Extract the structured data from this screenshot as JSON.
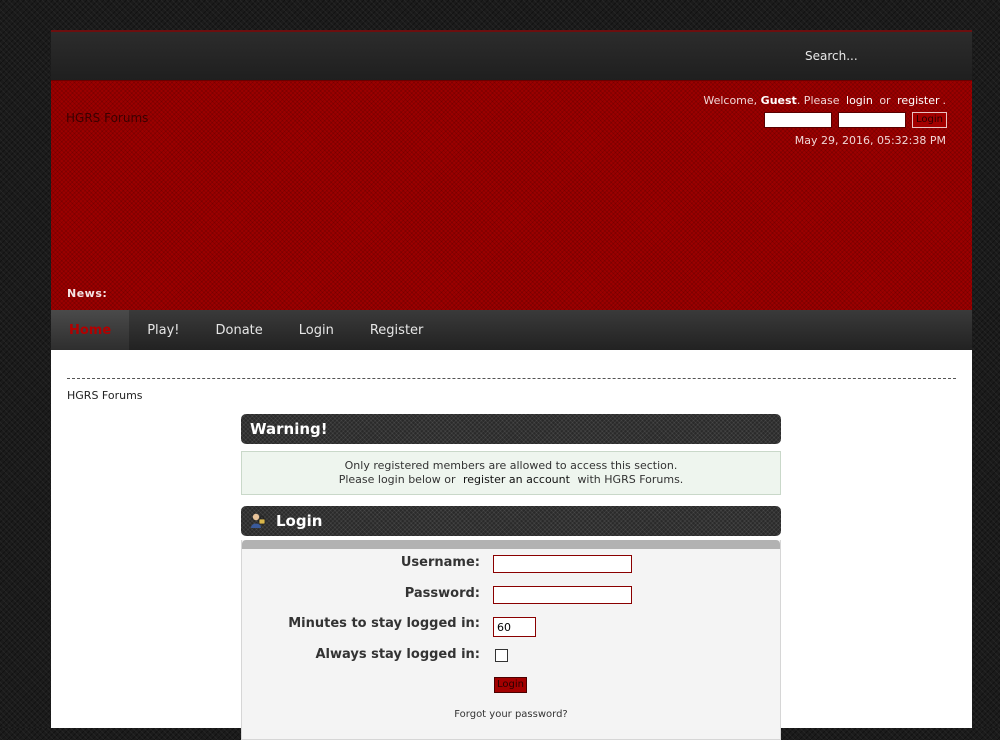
{
  "topbar": {
    "search_placeholder": "Search..."
  },
  "header": {
    "logo": "HGRS Forums",
    "welcome_prefix": "Welcome,",
    "guest": "Guest",
    "please": ". Please",
    "login_link": "login",
    "or": "or",
    "register_link": "register",
    "period": ".",
    "login_button": "Login",
    "datetime": "May 29, 2016, 05:32:38 PM",
    "news_label": "News:"
  },
  "nav": {
    "items": [
      {
        "label": "Home",
        "active": true
      },
      {
        "label": "Play!"
      },
      {
        "label": "Donate"
      },
      {
        "label": "Login"
      },
      {
        "label": "Register"
      }
    ]
  },
  "breadcrumb": "HGRS Forums",
  "warning": {
    "title": "Warning!",
    "line1": "Only registered members are allowed to access this section.",
    "line2_prefix": "Please login below or",
    "line2_link": "register an account",
    "line2_suffix": "with HGRS Forums."
  },
  "login": {
    "title": "Login",
    "username_label": "Username:",
    "password_label": "Password:",
    "minutes_label": "Minutes to stay logged in:",
    "minutes_value": "60",
    "always_label": "Always stay logged in:",
    "submit": "Login",
    "forgot": "Forgot your password?"
  },
  "colors": {
    "header_red": "#9c0000",
    "accent_red": "#b20000",
    "dark": "#2a2a2a"
  }
}
